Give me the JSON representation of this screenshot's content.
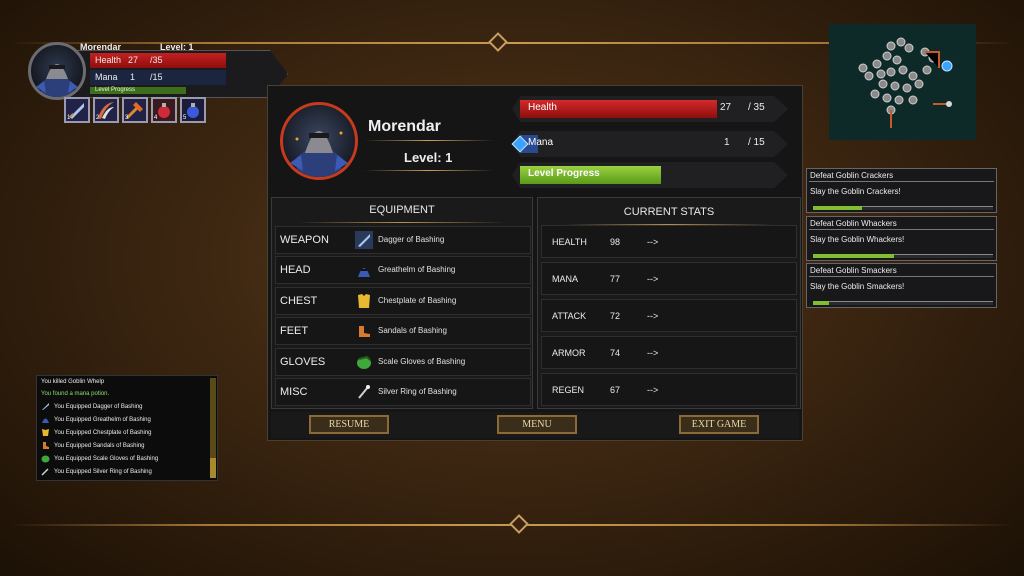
{
  "hud": {
    "name": "Morendar",
    "level_label": "Level:",
    "level": "1",
    "health_label": "Health",
    "health_current": "27",
    "health_max": "/35",
    "mana_label": "Mana",
    "mana_current": "1",
    "mana_max": "/15",
    "progress_label": "Level Progress",
    "hotbar": [
      {
        "num": "1",
        "icon": "dagger-icon"
      },
      {
        "num": "2",
        "icon": "claw-icon"
      },
      {
        "num": "3",
        "icon": "hammer-icon"
      },
      {
        "num": "4",
        "icon": "health-potion-icon"
      },
      {
        "num": "5",
        "icon": "mana-potion-icon"
      }
    ]
  },
  "character": {
    "name": "Morendar",
    "level_text": "Level: 1",
    "health_label": "Health",
    "health_current": "27",
    "health_max": "/ 35",
    "mana_label": "Mana",
    "mana_current": "1",
    "mana_max": "/ 15",
    "progress_label": "Level Progress",
    "health_fraction": 0.77,
    "mana_fraction": 0.07,
    "progress_fraction": 0.55
  },
  "equipment": {
    "title": "EQUIPMENT",
    "rows": [
      {
        "slot": "WEAPON",
        "item": "Dagger of Bashing",
        "icon": "dagger-icon"
      },
      {
        "slot": "HEAD",
        "item": "Greathelm of Bashing",
        "icon": "helm-icon"
      },
      {
        "slot": "CHEST",
        "item": "Chestplate of Bashing",
        "icon": "chestplate-icon"
      },
      {
        "slot": "FEET",
        "item": "Sandals of Bashing",
        "icon": "sandals-icon"
      },
      {
        "slot": "GLOVES",
        "item": "Scale Gloves of Bashing",
        "icon": "gloves-icon"
      },
      {
        "slot": "MISC",
        "item": "Silver Ring of Bashing",
        "icon": "ring-icon"
      }
    ]
  },
  "stats": {
    "title": "CURRENT STATS",
    "rows": [
      {
        "name": "HEALTH",
        "value": "98",
        "arrow": "-->"
      },
      {
        "name": "MANA",
        "value": "77",
        "arrow": "-->"
      },
      {
        "name": "ATTACK",
        "value": "72",
        "arrow": "-->"
      },
      {
        "name": "ARMOR",
        "value": "74",
        "arrow": "-->"
      },
      {
        "name": "REGEN",
        "value": "67",
        "arrow": "-->"
      }
    ]
  },
  "buttons": {
    "resume": "RESUME",
    "menu": "MENU",
    "exit": "EXIT GAME"
  },
  "quests": [
    {
      "title": "Defeat Goblin Crackers",
      "desc": "Slay the Goblin Crackers!",
      "progress": 0.27
    },
    {
      "title": "Defeat Goblin Whackers",
      "desc": "Slay the Goblin Whackers!",
      "progress": 0.45
    },
    {
      "title": "Defeat Goblin Smackers",
      "desc": "Slay the Goblin Smackers!",
      "progress": 0.09
    }
  ],
  "log": [
    {
      "text": "You killed Goblin Whelp",
      "color": "#ececec",
      "icon": ""
    },
    {
      "text": "You found a mana potion.",
      "color": "#8fe06a",
      "icon": ""
    },
    {
      "text": "You Equipped Dagger of Bashing",
      "color": "#ececec",
      "icon": "dagger-icon"
    },
    {
      "text": "You Equipped Greathelm of Bashing",
      "color": "#ececec",
      "icon": "helm-icon"
    },
    {
      "text": "You Equipped Chestplate of Bashing",
      "color": "#ececec",
      "icon": "chestplate-icon"
    },
    {
      "text": "You Equipped Sandals of Bashing",
      "color": "#ececec",
      "icon": "sandals-icon"
    },
    {
      "text": "You Equipped Scale Gloves of Bashing",
      "color": "#ececec",
      "icon": "gloves-icon"
    },
    {
      "text": "You Equipped Silver Ring of Bashing",
      "color": "#ececec",
      "icon": "ring-icon"
    }
  ],
  "colors": {
    "health": "#c42020",
    "mana_gem": "#3aa2ff",
    "progress": "#7fbf30",
    "accent_gold": "#c8a05a"
  }
}
